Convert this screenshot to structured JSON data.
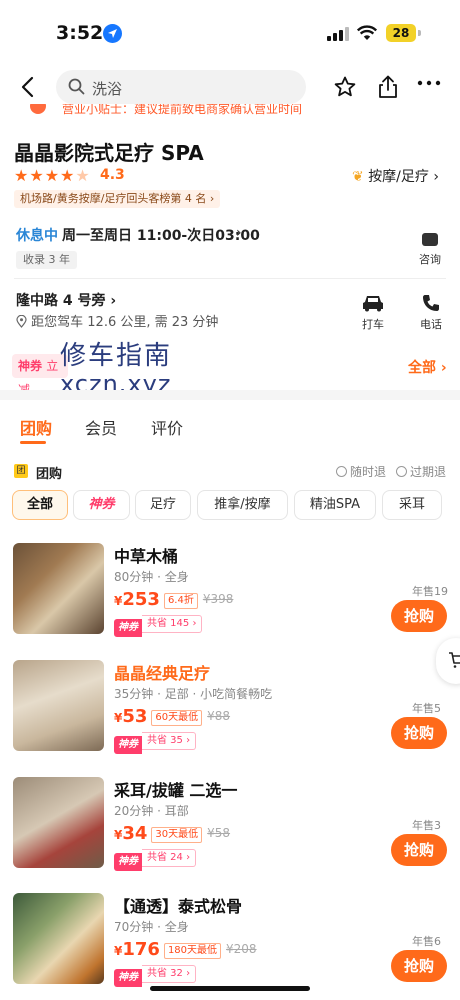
{
  "status_bar": {
    "time": "3:52",
    "battery": "28"
  },
  "search": {
    "query": "洗浴"
  },
  "notice": {
    "text": "营业小贴士：建议提前致电商家确认营业时间"
  },
  "shop": {
    "name": "晶晶影院式足疗 SPA",
    "rating": "4.3",
    "category": "按摩/足疗",
    "rank": "机场路/黄务按摩/足疗回头客榜第 4 名",
    "open_status": "休息中",
    "hours": "周一至周日 11:00-次日03:00",
    "record": "收录 3 年",
    "consult": "咨询",
    "address": "隆中路 4 号旁",
    "distance": "距您驾车 12.6 公里, 需 23 分钟",
    "taxi": "打车",
    "phone": "电话"
  },
  "promo": {
    "brand": "神券",
    "brand_suffix": "立减",
    "all": "全部",
    "watermark_cn": "修车指南",
    "watermark_en": "xczn.xyz"
  },
  "tabs": [
    {
      "label": "团购"
    },
    {
      "label": "会员"
    },
    {
      "label": "评价"
    }
  ],
  "group": {
    "title": "团购",
    "refund_any": "随时退",
    "refund_expire": "过期退"
  },
  "filters": [
    {
      "label": "全部"
    },
    {
      "label": "神券"
    },
    {
      "label": "足疗"
    },
    {
      "label": "推拿/按摩"
    },
    {
      "label": "精油SPA"
    },
    {
      "label": "采耳"
    }
  ],
  "deals": [
    {
      "name_a": "中草木桶",
      "name_b": "",
      "meta": "80分钟 · 全身",
      "price": "253",
      "discount": "6.4折",
      "orig": "¥398",
      "save": "共省 145",
      "sold": "年售19",
      "buy": "抢购"
    },
    {
      "name_a": "晶晶经典",
      "name_b": "足疗",
      "meta": "35分钟 · 足部 · 小吃简餐畅吃",
      "price": "53",
      "discount": "60天最低",
      "orig": "¥88",
      "save": "共省 35",
      "sold": "年售5",
      "buy": "抢购"
    },
    {
      "name_a": "采耳/拔罐 二选一",
      "name_b": "",
      "meta": "20分钟 · 耳部",
      "price": "34",
      "discount": "30天最低",
      "orig": "¥58",
      "save": "共省 24",
      "sold": "年售3",
      "buy": "抢购"
    },
    {
      "name_a": "【通透】泰式松骨",
      "name_b": "",
      "meta": "70分钟 · 全身",
      "price": "176",
      "discount": "180天最低",
      "orig": "¥208",
      "save": "共省 32",
      "sold": "年售6",
      "buy": "抢购"
    }
  ],
  "colors": {
    "accent": "#ff6a1a",
    "brand_pink": "#ff3d6b",
    "open_blue": "#2a86d6"
  }
}
